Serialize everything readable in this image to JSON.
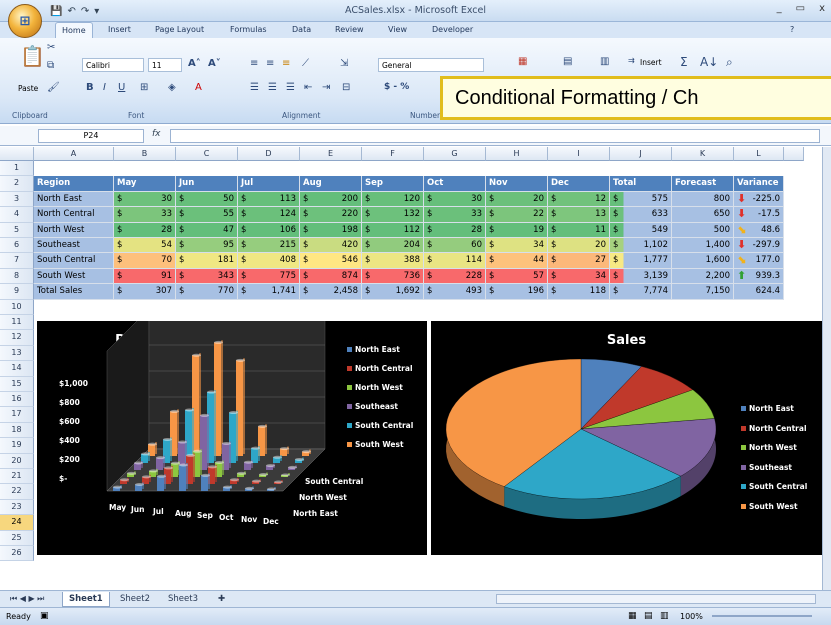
{
  "window": {
    "title": "ACSales.xlsx - Microsoft Excel",
    "controls": [
      "_",
      "▭",
      "x"
    ]
  },
  "ribbon_tabs": [
    "Home",
    "Insert",
    "Page Layout",
    "Formulas",
    "Data",
    "Review",
    "View",
    "Developer"
  ],
  "ribbon": {
    "clipboard": {
      "paste": "Paste",
      "label": "Clipboard"
    },
    "font": {
      "name": "Calibri",
      "size": "11",
      "label": "Font"
    },
    "alignment": {
      "label": "Alignment"
    },
    "number": {
      "format": "General",
      "label": "Number",
      "currency": "$ - %"
    },
    "cells": {
      "insert": "Insert"
    }
  },
  "callout": {
    "text": "Conditional Formatting / Ch"
  },
  "formula_bar": {
    "name_box": "P24",
    "fx": "fx",
    "value": ""
  },
  "columns": [
    "A",
    "B",
    "C",
    "D",
    "E",
    "F",
    "G",
    "H",
    "I",
    "J",
    "K",
    "L"
  ],
  "rows": [
    "1",
    "2",
    "3",
    "4",
    "5",
    "6",
    "7",
    "8",
    "9",
    "10",
    "11",
    "12",
    "13",
    "14",
    "15",
    "16",
    "17",
    "18",
    "19",
    "20",
    "21",
    "22",
    "23",
    "24",
    "25",
    "26"
  ],
  "table": {
    "headers": [
      "Region",
      "May",
      "Jun",
      "Jul",
      "Aug",
      "Sep",
      "Oct",
      "Nov",
      "Dec",
      "Total",
      "Forecast",
      "Variance"
    ],
    "rows": [
      {
        "region": "North East",
        "months": [
          "30",
          "50",
          "113",
          "200",
          "120",
          "30",
          "20",
          "12"
        ],
        "total": "575",
        "forecast": "800",
        "variance": "-225.0",
        "arrow": "down"
      },
      {
        "region": "North Central",
        "months": [
          "33",
          "55",
          "124",
          "220",
          "132",
          "33",
          "22",
          "13"
        ],
        "total": "633",
        "forecast": "650",
        "variance": "-17.5",
        "arrow": "down"
      },
      {
        "region": "North West",
        "months": [
          "28",
          "47",
          "106",
          "198",
          "112",
          "28",
          "19",
          "11"
        ],
        "total": "549",
        "forecast": "500",
        "variance": "48.6",
        "arrow": "side"
      },
      {
        "region": "Southeast",
        "months": [
          "54",
          "95",
          "215",
          "420",
          "204",
          "60",
          "34",
          "20"
        ],
        "total": "1,102",
        "forecast": "1,400",
        "variance": "-297.9",
        "arrow": "down"
      },
      {
        "region": "South Central",
        "months": [
          "70",
          "181",
          "408",
          "546",
          "388",
          "114",
          "44",
          "27"
        ],
        "total": "1,777",
        "forecast": "1,600",
        "variance": "177.0",
        "arrow": "side"
      },
      {
        "region": "South West",
        "months": [
          "91",
          "343",
          "775",
          "874",
          "736",
          "228",
          "57",
          "34"
        ],
        "total": "3,139",
        "forecast": "2,200",
        "variance": "939.3",
        "arrow": "up"
      },
      {
        "region": "Total Sales",
        "months": [
          "307",
          "770",
          "1,741",
          "2,458",
          "1,692",
          "493",
          "196",
          "118"
        ],
        "total": "7,774",
        "forecast": "7,150",
        "variance": "624.4",
        "arrow": "none"
      }
    ],
    "currency_symbol": "$"
  },
  "arrow_colors": {
    "down": "#e0302a",
    "side": "#f2b21b",
    "up": "#32a034"
  },
  "chart_data": [
    {
      "type": "bar",
      "title": "Performance",
      "categories": [
        "May",
        "Jun",
        "Jul",
        "Aug",
        "Sep",
        "Oct",
        "Nov",
        "Dec"
      ],
      "depth_labels": [
        "South Central",
        "North West",
        "North East"
      ],
      "ytick_labels": [
        "$1,000",
        "$800",
        "$600",
        "$400",
        "$200",
        "$-"
      ],
      "ylim": [
        0,
        1000
      ],
      "legend_position": "right",
      "series": [
        {
          "name": "North East",
          "color": "#4f81bd",
          "values": [
            30,
            50,
            113,
            200,
            120,
            30,
            20,
            12
          ]
        },
        {
          "name": "North Central",
          "color": "#c0392b",
          "values": [
            33,
            55,
            124,
            220,
            132,
            33,
            22,
            13
          ]
        },
        {
          "name": "North West",
          "color": "#8cc63f",
          "values": [
            28,
            47,
            106,
            198,
            112,
            28,
            19,
            11
          ]
        },
        {
          "name": "Southeast",
          "color": "#8064a2",
          "values": [
            54,
            95,
            215,
            420,
            204,
            60,
            34,
            20
          ]
        },
        {
          "name": "South Central",
          "color": "#2ea7c8",
          "values": [
            70,
            181,
            408,
            546,
            388,
            114,
            44,
            27
          ]
        },
        {
          "name": "South West",
          "color": "#f79646",
          "values": [
            91,
            343,
            775,
            874,
            736,
            228,
            57,
            34
          ]
        }
      ]
    },
    {
      "type": "pie",
      "title": "Sales",
      "legend_position": "right",
      "labels": [
        "North East",
        "North Central",
        "North West",
        "Southeast",
        "South Central",
        "South West"
      ],
      "values": [
        575,
        633,
        549,
        1102,
        1777,
        3139
      ],
      "colors": [
        "#4f81bd",
        "#c0392b",
        "#8cc63f",
        "#8064a2",
        "#2ea7c8",
        "#f79646"
      ]
    }
  ],
  "sheets": [
    "Sheet1",
    "Sheet2",
    "Sheet3"
  ],
  "status": {
    "ready": "Ready",
    "zoom": "100%"
  }
}
